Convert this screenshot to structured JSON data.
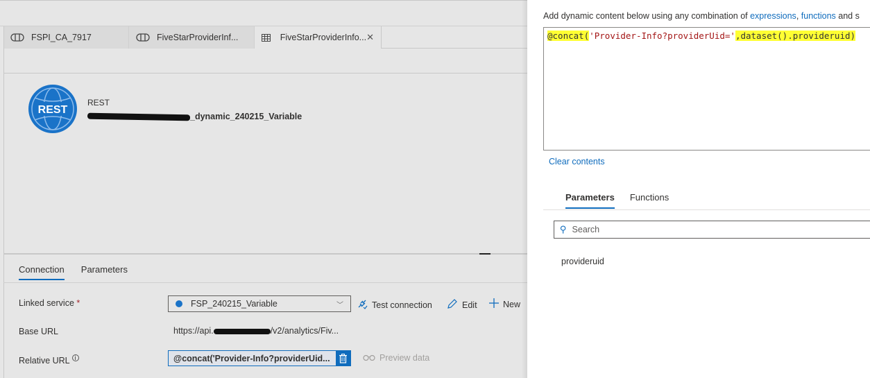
{
  "tabs": [
    {
      "label": "FSPI_CA_7917",
      "icon": "pipeline-icon",
      "active": false
    },
    {
      "label": "FiveStarProviderInf...",
      "icon": "pipeline-icon",
      "active": false
    },
    {
      "label": "FiveStarProviderInfo...",
      "icon": "table-icon",
      "active": true,
      "closable": true
    }
  ],
  "dataset": {
    "logo_text": "REST",
    "type": "REST",
    "name_visible": "_dynamic_240215_Variable"
  },
  "property_tabs": [
    {
      "label": "Connection",
      "active": true
    },
    {
      "label": "Parameters",
      "active": false
    }
  ],
  "form": {
    "linked_service_label": "Linked service",
    "required_mark": "*",
    "linked_service_value": "FSP_240215_Variable",
    "test_connection": "Test connection",
    "edit": "Edit",
    "new": "New",
    "base_url_label": "Base URL",
    "base_url_prefix": "https://api.",
    "base_url_suffix": "/v2/analytics/Fiv...",
    "relative_url_label": "Relative URL",
    "relative_url_value": "@concat('Provider-Info?providerUid...",
    "preview_data": "Preview data"
  },
  "panel": {
    "intro_prefix": "Add dynamic content below using any combination of ",
    "intro_link1": "expressions",
    "intro_sep": ", ",
    "intro_link2": "functions",
    "intro_suffix": " and s",
    "expression_part1": "@concat(",
    "expression_part2": "'Provider-Info?providerUid='",
    "expression_part3": ",dataset().provideruid)",
    "clear_contents": "Clear contents",
    "tabs": [
      {
        "label": "Parameters",
        "active": true
      },
      {
        "label": "Functions",
        "active": false
      }
    ],
    "search_placeholder": "Search",
    "parameters": [
      "provideruid"
    ]
  },
  "colors": {
    "accent": "#0f6cbd",
    "highlight": "#ffff33"
  }
}
